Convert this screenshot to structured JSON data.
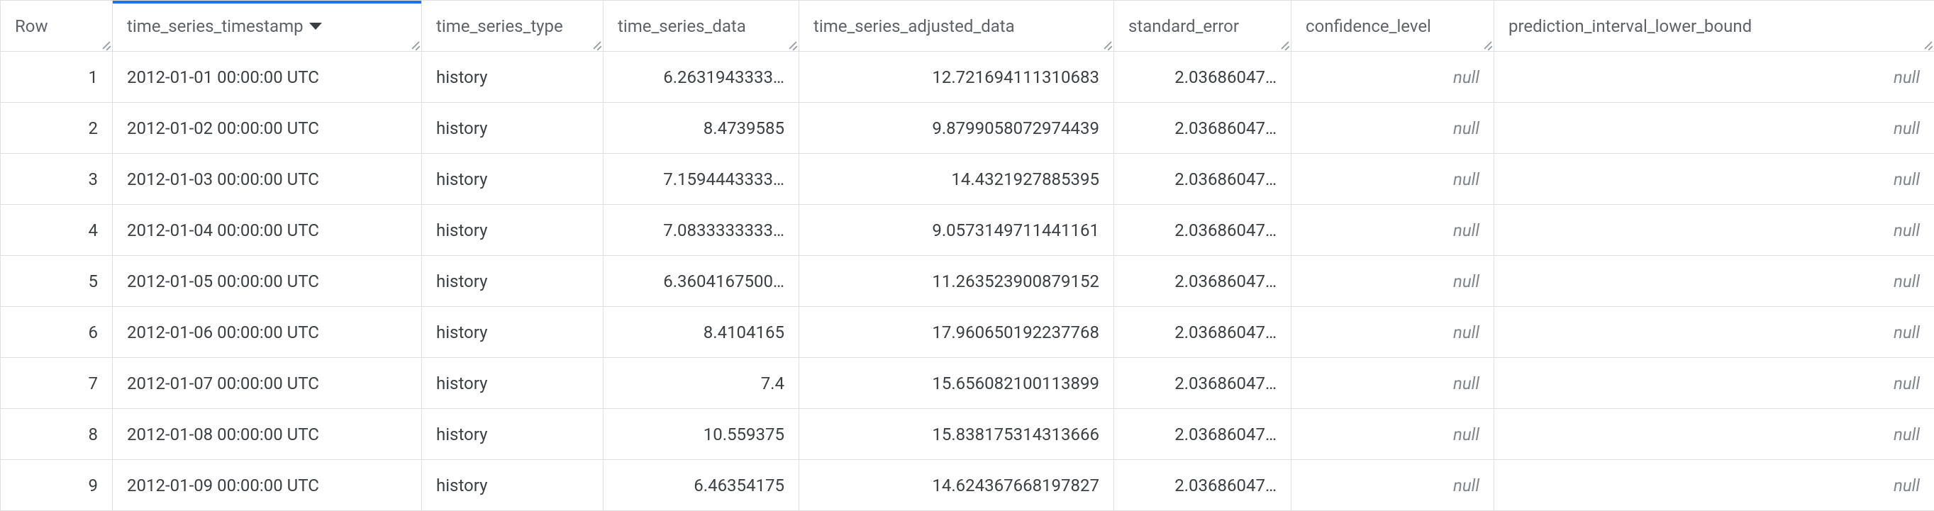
{
  "columns": [
    {
      "key": "row",
      "label": "Row",
      "cls": "col-row",
      "align": "num",
      "sorted": false
    },
    {
      "key": "ts",
      "label": "time_series_timestamp",
      "cls": "col-ts",
      "align": "text",
      "sorted": true
    },
    {
      "key": "type",
      "label": "time_series_type",
      "cls": "col-type",
      "align": "text",
      "sorted": false
    },
    {
      "key": "data",
      "label": "time_series_data",
      "cls": "col-data",
      "align": "num",
      "sorted": false
    },
    {
      "key": "adj",
      "label": "time_series_adjusted_data",
      "cls": "col-adj",
      "align": "num",
      "sorted": false
    },
    {
      "key": "se",
      "label": "standard_error",
      "cls": "col-se",
      "align": "num",
      "sorted": false
    },
    {
      "key": "conf",
      "label": "confidence_level",
      "cls": "col-conf",
      "align": "null",
      "sorted": false
    },
    {
      "key": "pred",
      "label": "prediction_interval_lower_bound",
      "cls": "col-pred",
      "align": "null",
      "sorted": false
    }
  ],
  "null_label": "null",
  "rows": [
    {
      "row": "1",
      "ts": "2012-01-01 00:00:00 UTC",
      "type": "history",
      "data": "6.2631943333…",
      "adj": "12.721694111310683",
      "se": "2.03686047…",
      "conf": null,
      "pred": null
    },
    {
      "row": "2",
      "ts": "2012-01-02 00:00:00 UTC",
      "type": "history",
      "data": "8.4739585",
      "adj": "9.8799058072974439",
      "se": "2.03686047…",
      "conf": null,
      "pred": null
    },
    {
      "row": "3",
      "ts": "2012-01-03 00:00:00 UTC",
      "type": "history",
      "data": "7.1594443333…",
      "adj": "14.4321927885395",
      "se": "2.03686047…",
      "conf": null,
      "pred": null
    },
    {
      "row": "4",
      "ts": "2012-01-04 00:00:00 UTC",
      "type": "history",
      "data": "7.0833333333…",
      "adj": "9.0573149711441161",
      "se": "2.03686047…",
      "conf": null,
      "pred": null
    },
    {
      "row": "5",
      "ts": "2012-01-05 00:00:00 UTC",
      "type": "history",
      "data": "6.3604167500…",
      "adj": "11.263523900879152",
      "se": "2.03686047…",
      "conf": null,
      "pred": null
    },
    {
      "row": "6",
      "ts": "2012-01-06 00:00:00 UTC",
      "type": "history",
      "data": "8.4104165",
      "adj": "17.960650192237768",
      "se": "2.03686047…",
      "conf": null,
      "pred": null
    },
    {
      "row": "7",
      "ts": "2012-01-07 00:00:00 UTC",
      "type": "history",
      "data": "7.4",
      "adj": "15.656082100113899",
      "se": "2.03686047…",
      "conf": null,
      "pred": null
    },
    {
      "row": "8",
      "ts": "2012-01-08 00:00:00 UTC",
      "type": "history",
      "data": "10.559375",
      "adj": "15.838175314313666",
      "se": "2.03686047…",
      "conf": null,
      "pred": null
    },
    {
      "row": "9",
      "ts": "2012-01-09 00:00:00 UTC",
      "type": "history",
      "data": "6.46354175",
      "adj": "14.624367668197827",
      "se": "2.03686047…",
      "conf": null,
      "pred": null
    }
  ]
}
